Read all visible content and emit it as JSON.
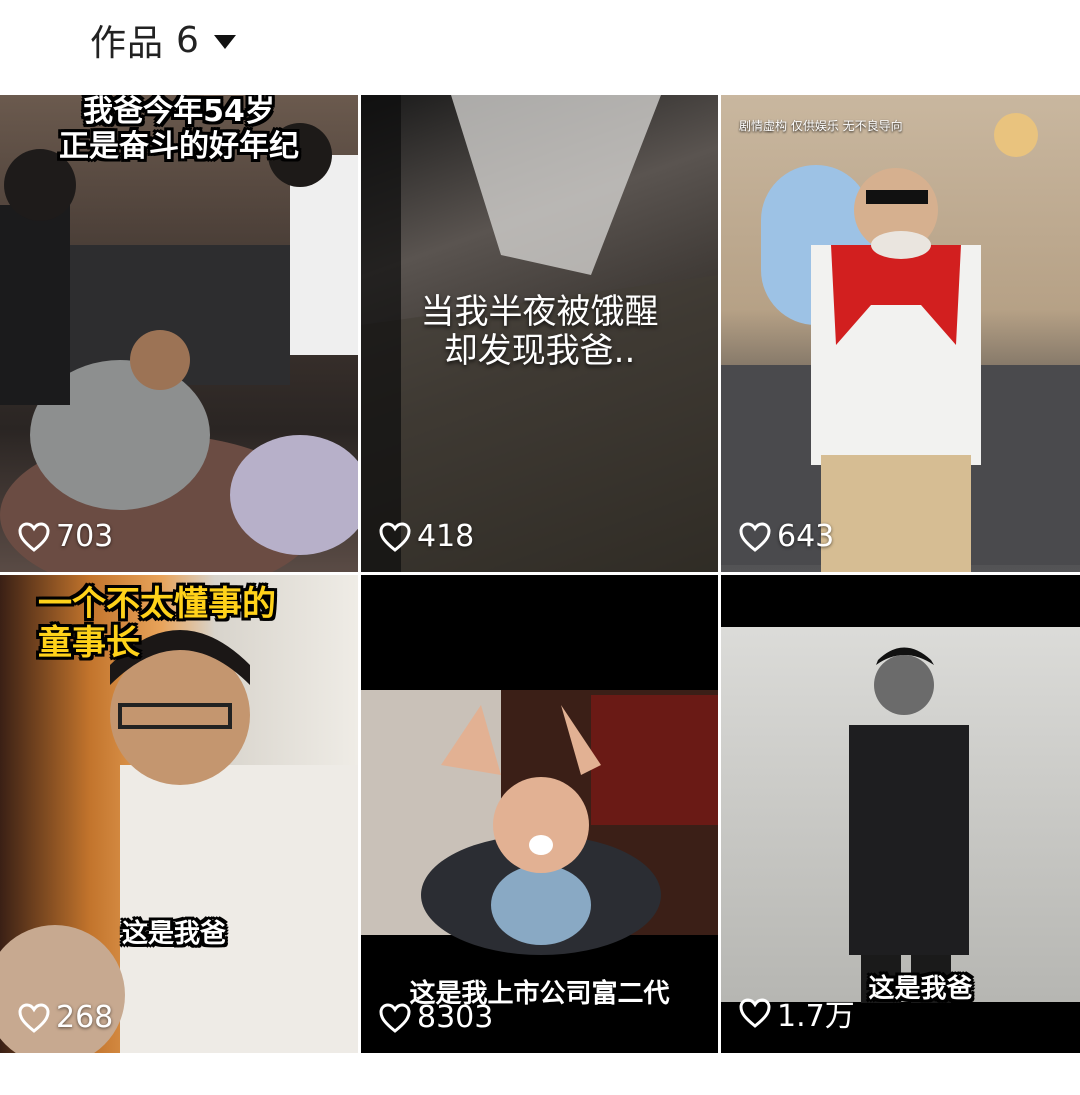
{
  "header": {
    "works_label": "作品",
    "works_count": "6"
  },
  "videos": [
    {
      "caption": "我爸今年54岁\n正是奋斗的好年纪",
      "likes": "703"
    },
    {
      "caption": "当我半夜被饿醒\n却发现我爸..",
      "likes": "418"
    },
    {
      "caption": "剧情虚构 仅供娱乐 无不良导向",
      "likes": "643"
    },
    {
      "caption": "一个不太懂事的\n童事长",
      "subcaption": "这是我爸",
      "likes": "268"
    },
    {
      "caption": "这是我上市公司富二代",
      "likes": "8303"
    },
    {
      "caption": "这是我爸",
      "likes": "1.7万"
    }
  ]
}
